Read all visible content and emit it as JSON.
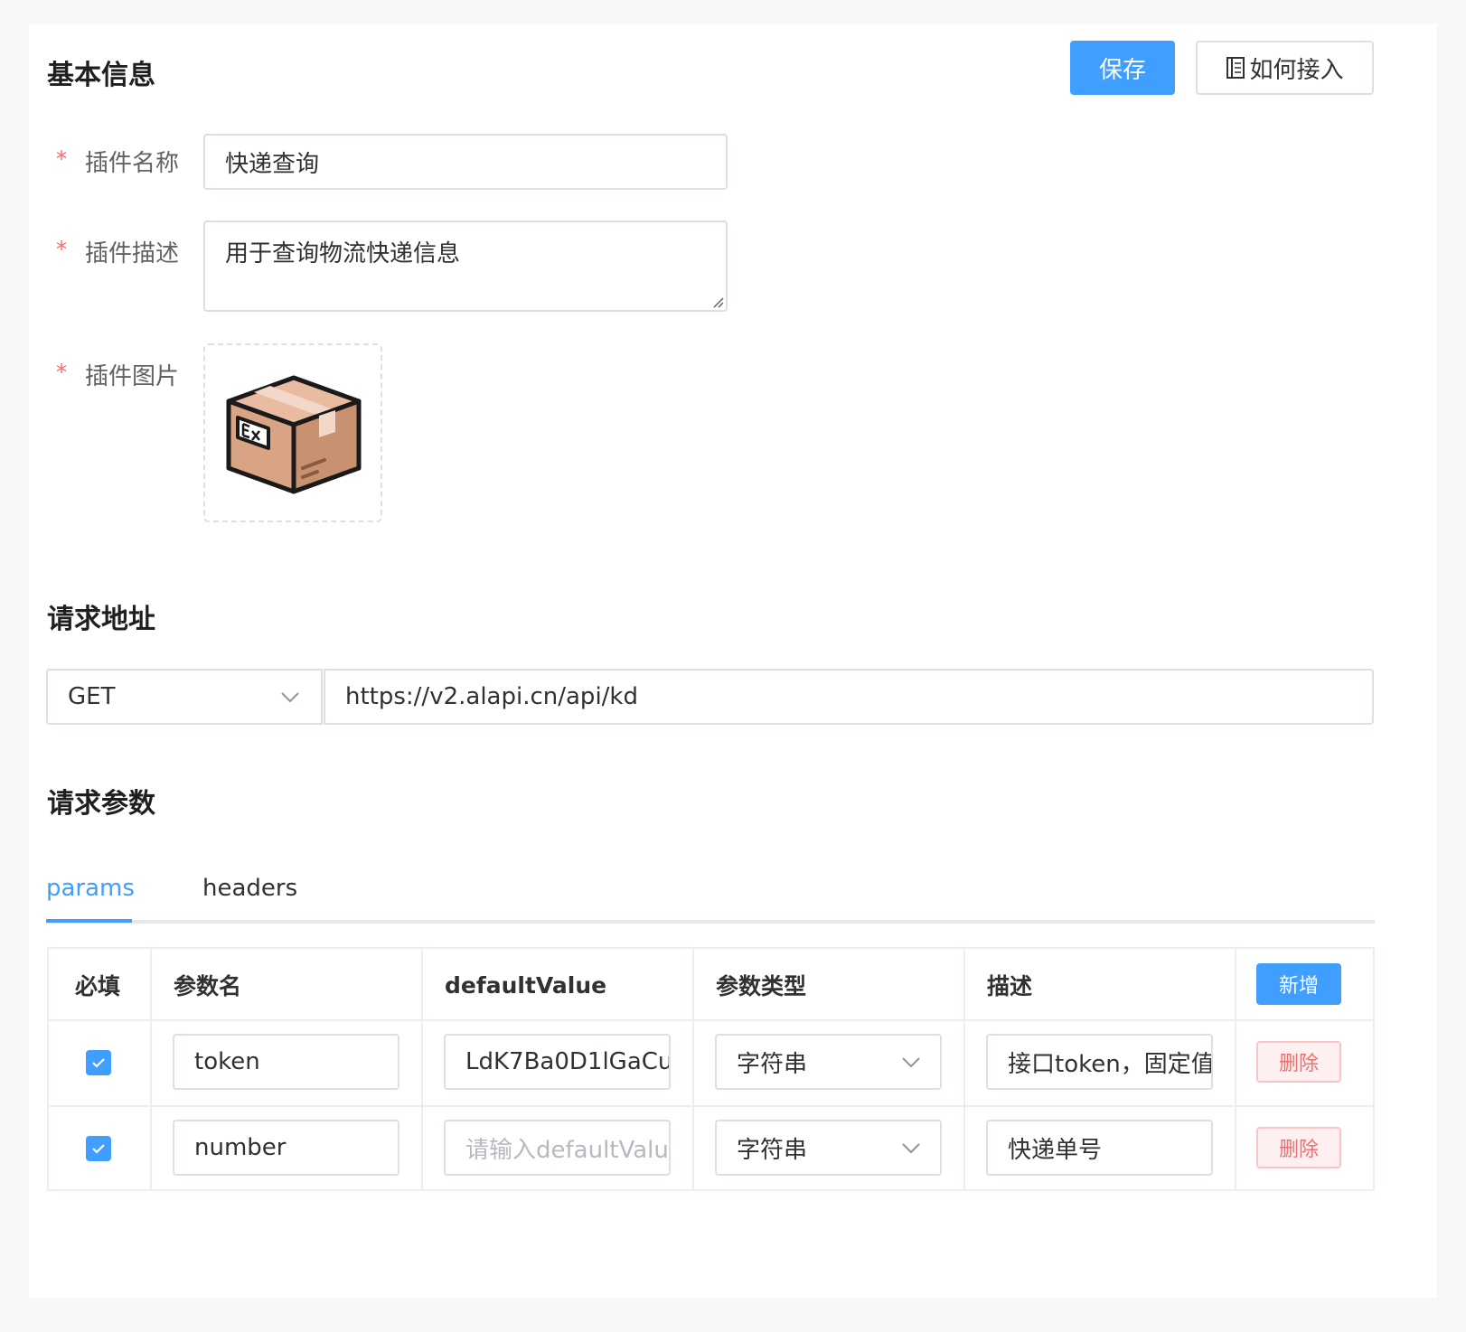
{
  "basic_info": {
    "title": "基本信息",
    "save_label": "保存",
    "howto_label": "如何接入",
    "howto_icon": "document-icon",
    "fields": {
      "required_mark": "*",
      "name_label": "插件名称",
      "name_value": "快递查询",
      "desc_label": "插件描述",
      "desc_value": "用于查询物流快递信息",
      "image_label": "插件图片",
      "image_icon": "package-box-icon"
    }
  },
  "request_url": {
    "title": "请求地址",
    "method": "GET",
    "url": "https://v2.alapi.cn/api/kd"
  },
  "request_params": {
    "title": "请求参数",
    "tabs": [
      {
        "label": "params",
        "active": true
      },
      {
        "label": "headers",
        "active": false
      }
    ],
    "table": {
      "headers": {
        "required": "必填",
        "name": "参数名",
        "default": "defaultValue",
        "type": "参数类型",
        "desc": "描述"
      },
      "add_label": "新增",
      "delete_label": "删除",
      "default_placeholder": "请输入defaultValue",
      "rows": [
        {
          "checked": true,
          "name": "token",
          "default": "LdK7Ba0D1lGaCu",
          "type": "字符串",
          "desc": "接口token，固定值"
        },
        {
          "checked": true,
          "name": "number",
          "default": "",
          "type": "字符串",
          "desc": "快递单号"
        }
      ]
    }
  },
  "colors": {
    "primary": "#409eff",
    "danger": "#f56c6c",
    "border": "#dcdfe6"
  }
}
